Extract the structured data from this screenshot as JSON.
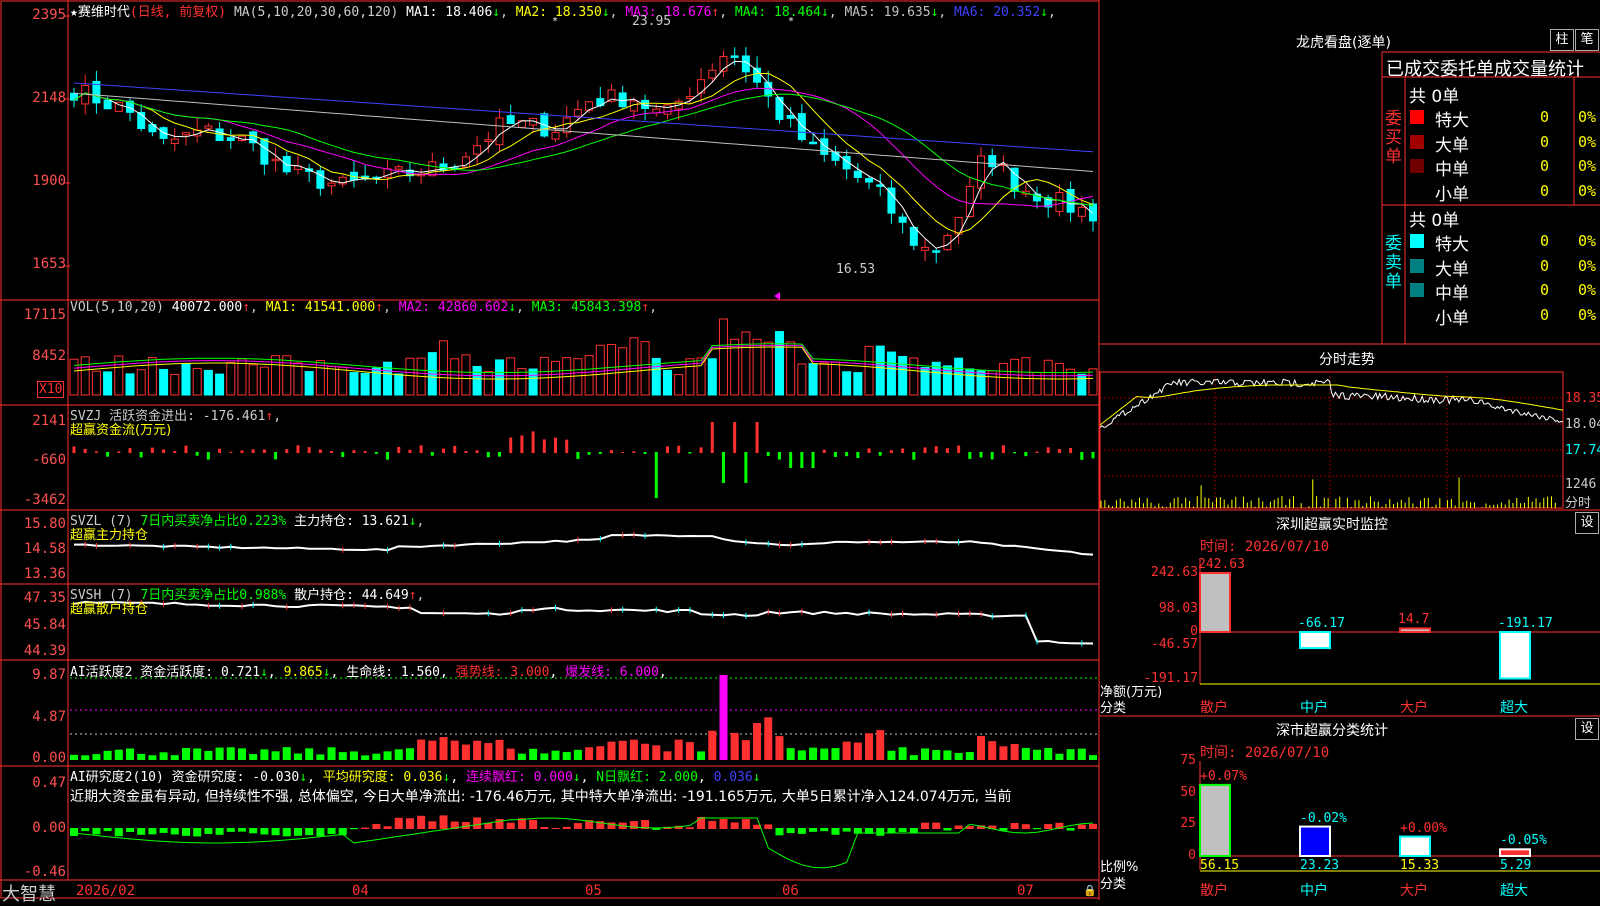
{
  "main": {
    "title": "★赛维时代",
    "period": "(日线, 前复权)",
    "ma_label": "MA(5,10,20,30,60,120)",
    "ma_values": [
      {
        "name": "MA1",
        "value": "18.406",
        "arrow": "↓",
        "color": "#ffffff"
      },
      {
        "name": "MA2",
        "value": "18.350",
        "arrow": "↓",
        "color": "#ffff00"
      },
      {
        "name": "MA3",
        "value": "18.676",
        "arrow": "↑",
        "color": "#ff00ff"
      },
      {
        "name": "MA4",
        "value": "18.464",
        "arrow": "↓",
        "color": "#00ff00"
      },
      {
        "name": "MA5",
        "value": "19.635",
        "arrow": "↓",
        "color": "#c0c0c0"
      },
      {
        "name": "MA6",
        "value": "20.352",
        "arrow": "↓",
        "color": "#4040ff"
      }
    ],
    "y_ticks": [
      "2395",
      "2148",
      "1900",
      "1653"
    ],
    "high_label": "23.95",
    "low_label": "16.53"
  },
  "vol": {
    "label": "VOL(5,10,20)",
    "value": "40072.000",
    "items": [
      {
        "name": "MA1",
        "value": "41541.000",
        "arrow": "↑",
        "color": "#ffff00"
      },
      {
        "name": "MA2",
        "value": "42860.602",
        "arrow": "↓",
        "color": "#ff00ff"
      },
      {
        "name": "MA3",
        "value": "45843.398",
        "arrow": "↑",
        "color": "#00ff00"
      }
    ],
    "y_ticks": [
      "17115",
      "8452"
    ],
    "unit": "X10"
  },
  "svzj": {
    "label": "SVZJ  活跃资金进出: -176.461",
    "arrow": "↑",
    "sub": "超赢资金流(万元)",
    "y_ticks": [
      "2141",
      "-660",
      "-3462"
    ]
  },
  "svzl": {
    "label": "SVZL (7)",
    "ratio": "7日内买卖净占比0.223%",
    "hold": "主力持仓: 13.621",
    "arrow": "↓",
    "sub": "超赢主力持仓",
    "y_ticks": [
      "15.80",
      "14.58",
      "13.36"
    ]
  },
  "svsh": {
    "label": "SVSH (7)",
    "ratio": "7日内买卖净占比0.988%",
    "hold": "散户持仓: 44.649",
    "arrow": "↑",
    "sub": "超赢散户持仓",
    "y_ticks": [
      "47.35",
      "45.84",
      "44.39"
    ]
  },
  "ai1": {
    "label": "AI活跃度2 资金活跃度: 0.721",
    "v2": "9.865",
    "life": "生命线: 1.560",
    "strong": "强势线: 3.000",
    "burst": "爆发线: 6.000",
    "y_ticks": [
      "9.87",
      "4.87",
      "0.00"
    ]
  },
  "ai2": {
    "label": "AI研究度2(10) 资金研究度: -0.030",
    "avg": "平均研究度: 0.036",
    "red": "连续飘红: 0.000",
    "n": "N日飘红: 2.000",
    "last": "0.036",
    "text": "近期大资金虽有异动, 但持续性不强, 总体偏空, 今日大单净流出: -176.46万元, 其中特大单净流出: -191.165万元, 大单5日累计净入124.074万元, 当前",
    "y_ticks": [
      "0.47",
      "0.00",
      "-0.46"
    ]
  },
  "bottom": {
    "brand": "大智慧",
    "dates": [
      "2026/02",
      "04",
      "05",
      "06",
      "07"
    ]
  },
  "right": {
    "lhb_title": "龙虎看盘(逐单)",
    "btn1": "柱",
    "btn2": "笔",
    "header": "已成交委托单成交量统计",
    "buy_label": "委买单",
    "sell_label": "委卖单",
    "buy_total": "共 0单",
    "sell_total": "共 0单",
    "buy_rows": [
      {
        "name": "特大",
        "v": "0",
        "p": "0%",
        "color": "#ff0000"
      },
      {
        "name": "大单",
        "v": "0",
        "p": "0%",
        "color": "#a00000"
      },
      {
        "name": "中单",
        "v": "0",
        "p": "0%",
        "color": "#700000"
      },
      {
        "name": "小单",
        "v": "0",
        "p": "0%",
        "color": ""
      }
    ],
    "sell_rows": [
      {
        "name": "特大",
        "v": "0",
        "p": "0%",
        "color": "#00ffff"
      },
      {
        "name": "大单",
        "v": "0",
        "p": "0%",
        "color": "#008080"
      },
      {
        "name": "中单",
        "v": "0",
        "p": "0%",
        "color": "#008080"
      },
      {
        "name": "小单",
        "v": "0",
        "p": "0%",
        "color": ""
      }
    ],
    "ts_title": "分时走势",
    "ts_ticks": [
      "18.35",
      "18.04",
      "17.74"
    ],
    "ts_vol": "1246",
    "ts_bottom": "分时",
    "mon_title": "深圳超赢实时监控",
    "mon_btn": "设",
    "mon_time": "时间: 2026/07/10",
    "mon_ticks": [
      "242.63",
      "98.03",
      "0",
      "-46.57",
      "-191.17"
    ],
    "mon_unit": "净额(万元)",
    "mon_cat": "分类",
    "mon_bars": [
      {
        "label": "散户",
        "value": "242.63",
        "num": 242.63
      },
      {
        "label": "中户",
        "value": "-66.17",
        "num": -66.17
      },
      {
        "label": "大户",
        "value": "14.7",
        "num": 14.7
      },
      {
        "label": "超大",
        "value": "-191.17",
        "num": -191.17
      }
    ],
    "cls_title": "深市超赢分类统计",
    "cls_btn": "设",
    "cls_time": "时间: 2026/07/10",
    "cls_ticks": [
      "75",
      "50",
      "25",
      "0"
    ],
    "cls_unit": "比例%",
    "cls_cat": "分类",
    "cls_bars": [
      {
        "label": "散户",
        "value": "56.15",
        "change": "+0.07%",
        "num": 56.15
      },
      {
        "label": "中户",
        "value": "23.23",
        "change": "-0.02%",
        "num": 23.23
      },
      {
        "label": "大户",
        "value": "15.33",
        "change": "+0.00%",
        "num": 15.33
      },
      {
        "label": "超大",
        "value": "5.29",
        "change": "-0.05%",
        "num": 5.29
      }
    ]
  }
}
